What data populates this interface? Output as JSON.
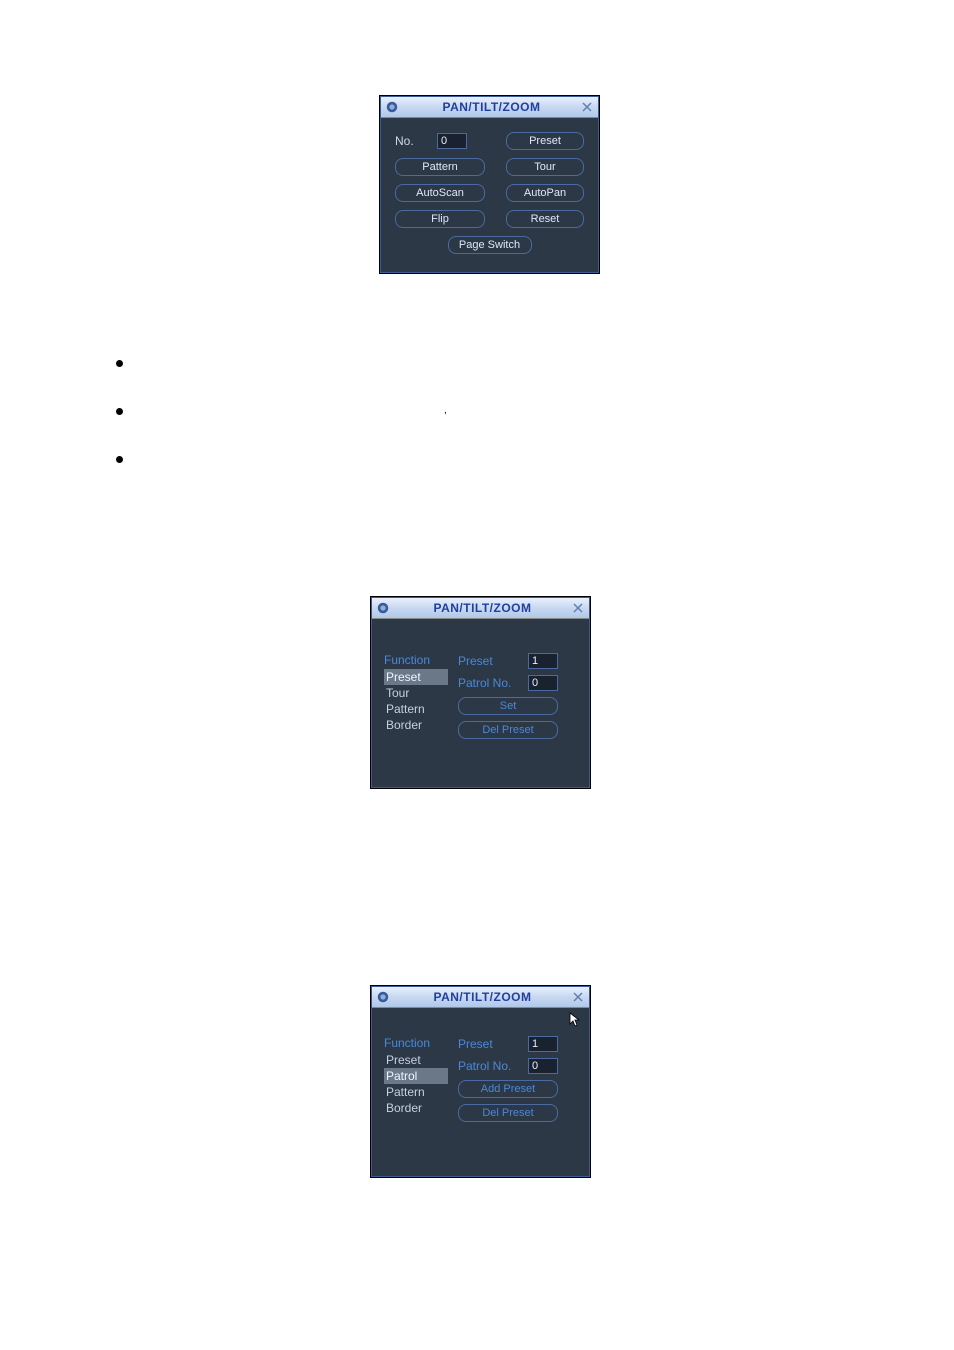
{
  "dialog1": {
    "title": "PAN/TILT/ZOOM",
    "no_label": "No.",
    "no_value": "0",
    "preset": "Preset",
    "pattern": "Pattern",
    "tour": "Tour",
    "autoscan": "AutoScan",
    "autopan": "AutoPan",
    "flip": "Flip",
    "reset": "Reset",
    "page_switch": "Page Switch"
  },
  "dialog2": {
    "title": "PAN/TILT/ZOOM",
    "function_label": "Function",
    "items": [
      "Preset",
      "Tour",
      "Pattern",
      "Border"
    ],
    "selected_index": 0,
    "preset_label": "Preset",
    "preset_value": "1",
    "patrol_label": "Patrol No.",
    "patrol_value": "0",
    "btn_set": "Set",
    "btn_del": "Del Preset"
  },
  "dialog3": {
    "title": "PAN/TILT/ZOOM",
    "function_label": "Function",
    "items": [
      "Preset",
      "Patrol",
      "Pattern",
      "Border"
    ],
    "selected_index": 1,
    "preset_label": "Preset",
    "preset_value": "1",
    "patrol_label": "Patrol No.",
    "patrol_value": "0",
    "btn_add": "Add Preset",
    "btn_del": "Del Preset"
  }
}
